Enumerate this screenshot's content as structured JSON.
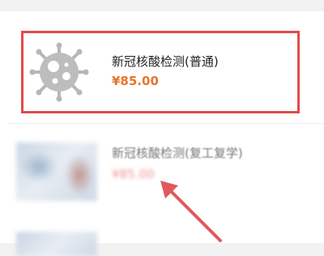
{
  "items": [
    {
      "name": "新冠核酸检测(普通)",
      "price": "¥85.00",
      "icon": "virus-icon"
    },
    {
      "name": "新冠核酸检测(复工复学)",
      "price": "¥85.00",
      "icon": "blurred-thumbnail"
    }
  ],
  "colors": {
    "highlight_border": "#e14b4b",
    "price": "#e8742e",
    "arrow": "#e05a5a"
  }
}
